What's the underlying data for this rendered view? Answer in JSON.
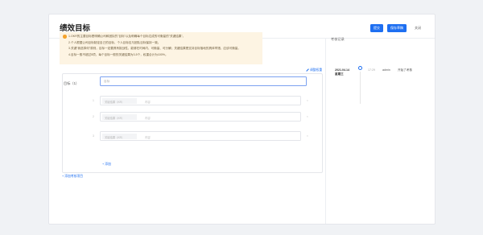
{
  "page": {
    "title": "绩效目标"
  },
  "toolbar": {
    "submit_label": "提交",
    "save_draft_label": "保存草稿",
    "close_label": "关闭"
  },
  "notice": {
    "lines": [
      "1.OKR的主要目标是明确公司和团队的\"目标\"以及明确每个目标达成的可衡量的\"关键结果\"。",
      "2.个人根据公司目标制定自己的目标，个人目标应与团队目标保持一致。",
      "3.关键\"我选择何\"原则，目标一定要具有挑战性，能够在时间内、可衡量、可分解；关键结果是支持目标落地的具体举措，应该可衡量。",
      "4.目标一般不超过5项，每个目标一般的关键结果为3-5个，权重合计为100%。"
    ]
  },
  "goal": {
    "edit_weight_label": "调整权重",
    "label": "目标（1）",
    "input_placeholder": "目标",
    "krs": [
      {
        "index": "1",
        "tag": "关键结果（KR）",
        "placeholder": "内容"
      },
      {
        "index": "2",
        "tag": "关键结果（KR）",
        "placeholder": "内容"
      },
      {
        "index": "3",
        "tag": "关键结果（KR）",
        "placeholder": "内容"
      }
    ],
    "add_kr_label": "+ 添加",
    "add_goal_label": "+ 添加考核项目"
  },
  "sidebar": {
    "title": "考核记录",
    "records": [
      {
        "date": "2021.04.14 星期三",
        "time": "17:29",
        "user": "admin",
        "action": "开始了考核"
      }
    ]
  },
  "colors": {
    "primary": "#1e6ff1",
    "notice_bg": "#fdf4e3",
    "warning": "#f4a32c"
  },
  "icons": [
    "warning-icon",
    "pencil-icon",
    "close-icon",
    "timeline-dot-icon"
  ]
}
